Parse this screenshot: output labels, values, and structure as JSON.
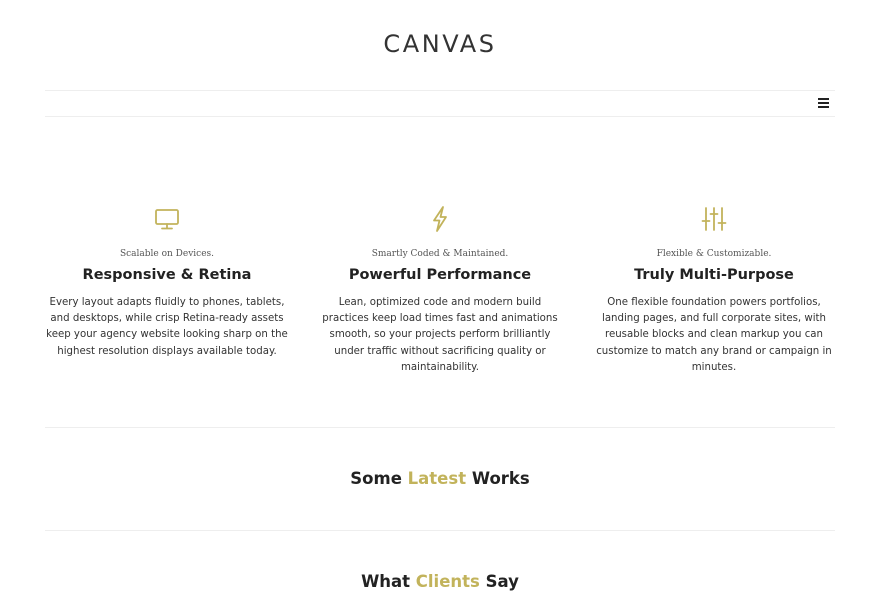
{
  "header": {
    "logo": "CANVAS"
  },
  "nav": {
    "menu_icon": "hamburger-menu-icon"
  },
  "colors": {
    "accent": "#c2b35b",
    "text": "#222222",
    "divider": "#eeeeee"
  },
  "features": [
    {
      "icon": "monitor-icon",
      "tag": "Scalable on Devices.",
      "title": "Responsive & Retina",
      "text": "Every layout adapts fluidly to phones, tablets, and desktops, while crisp Retina-ready assets keep your agency website looking sharp on the highest resolution displays available today."
    },
    {
      "icon": "lightning-icon",
      "tag": "Smartly Coded & Maintained.",
      "title": "Powerful Performance",
      "text": "Lean, optimized code and modern build practices keep load times fast and animations smooth, so your projects perform brilliantly under traffic without sacrificing quality or maintainability."
    },
    {
      "icon": "sliders-icon",
      "tag": "Flexible & Customizable.",
      "title": "Truly Multi-Purpose",
      "text": "One flexible foundation powers portfolios, landing pages, and full corporate sites, with reusable blocks and clean markup you can customize to match any brand or campaign in minutes."
    }
  ],
  "sections": {
    "works": {
      "before": "Some",
      "accent": "Latest",
      "after": "Works"
    },
    "clients": {
      "before": "What",
      "accent": "Clients",
      "after": "Say"
    }
  }
}
